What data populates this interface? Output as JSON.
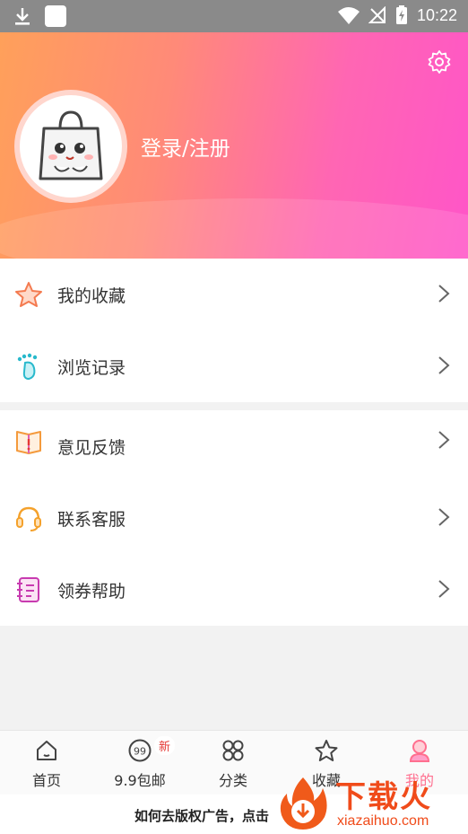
{
  "status_bar": {
    "time": "10:22"
  },
  "header": {
    "login_label": "登录/注册"
  },
  "menu_group_1": [
    {
      "label": "我的收藏",
      "icon": "star-icon"
    },
    {
      "label": "浏览记录",
      "icon": "footprint-icon"
    }
  ],
  "menu_group_2": [
    {
      "label": "意见反馈",
      "icon": "feedback-book-icon"
    },
    {
      "label": "联系客服",
      "icon": "headset-icon"
    },
    {
      "label": "领券帮助",
      "icon": "notebook-icon"
    }
  ],
  "bottom_nav": [
    {
      "label": "首页",
      "icon": "home-icon"
    },
    {
      "label": "9.9包邮",
      "icon": "nine-nine-icon",
      "badge": "新"
    },
    {
      "label": "分类",
      "icon": "grid-icon"
    },
    {
      "label": "收藏",
      "icon": "star-outline-icon"
    },
    {
      "label": "我的",
      "icon": "user-icon"
    }
  ],
  "ad_bar": {
    "text": "如何去版权广告，点击"
  },
  "watermark": {
    "title": "下载火",
    "url": "xiazaihuo.com"
  },
  "colors": {
    "accent": "#ff5fbf",
    "header_start": "#ffa05a",
    "header_end": "#ff55c8"
  }
}
